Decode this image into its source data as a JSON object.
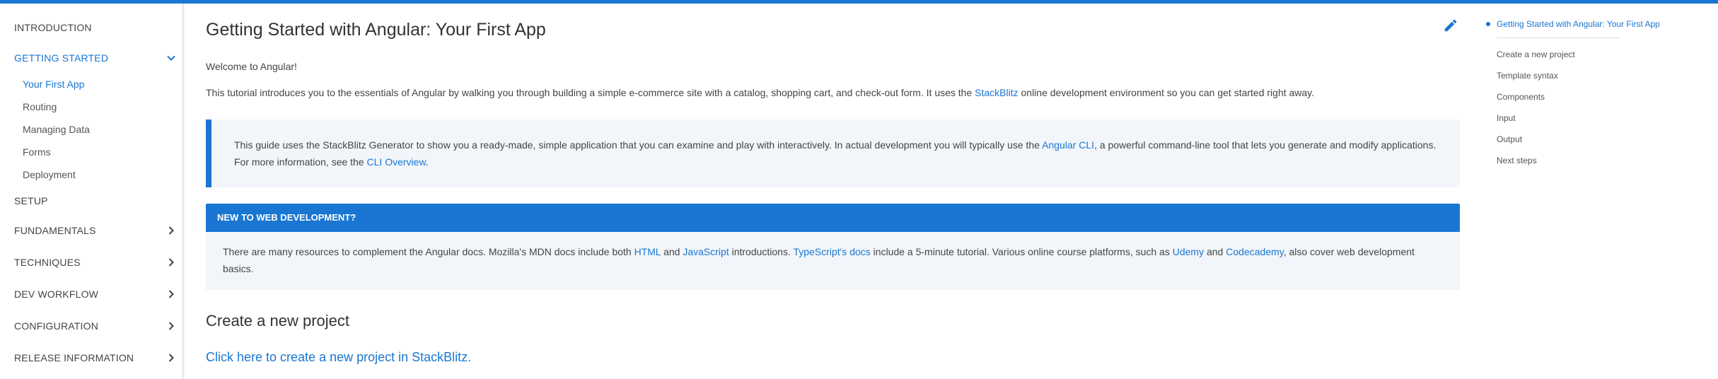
{
  "sidebar": {
    "top_items": [
      {
        "label": "INTRODUCTION"
      },
      {
        "label": "GETTING STARTED"
      },
      {
        "label": "SETUP"
      },
      {
        "label": "FUNDAMENTALS"
      },
      {
        "label": "TECHNIQUES"
      },
      {
        "label": "DEV WORKFLOW"
      },
      {
        "label": "CONFIGURATION"
      },
      {
        "label": "RELEASE INFORMATION"
      }
    ],
    "getting_started_children": [
      {
        "label": "Your First App"
      },
      {
        "label": "Routing"
      },
      {
        "label": "Managing Data"
      },
      {
        "label": "Forms"
      },
      {
        "label": "Deployment"
      }
    ]
  },
  "main": {
    "title": "Getting Started with Angular: Your First App",
    "welcome": "Welcome to Angular!",
    "intro_before": "This tutorial introduces you to the essentials of Angular by walking you through building a simple e-commerce site with a catalog, shopping cart, and check-out form. It uses the ",
    "intro_link": "StackBlitz",
    "intro_after": " online development environment so you can get started right away.",
    "callout1": {
      "before": "This guide uses the StackBlitz Generator to show you a ready-made, simple application that you can examine and play with interactively. In actual development you will typically use the ",
      "link1": "Angular CLI",
      "middle": ", a powerful command-line tool that lets you generate and modify applications. For more information, see the ",
      "link2": "CLI Overview",
      "after": "."
    },
    "callout2": {
      "header": "NEW TO WEB DEVELOPMENT?",
      "t1": "There are many resources to complement the Angular docs. Mozilla's MDN docs include both ",
      "l1": "HTML",
      "t2": " and ",
      "l2": "JavaScript",
      "t3": " introductions. ",
      "l3": "TypeScript's docs",
      "t4": " include a 5-minute tutorial. Various online course platforms, such as ",
      "l4": "Udemy",
      "t5": " and ",
      "l5": "Codecademy",
      "t6": ", also cover web development basics."
    },
    "section_heading": "Create a new project",
    "section_link": "Click here to create a new project in StackBlitz."
  },
  "toc": {
    "items": [
      {
        "label": "Getting Started with Angular: Your First App"
      },
      {
        "label": "Create a new project"
      },
      {
        "label": "Template syntax"
      },
      {
        "label": "Components"
      },
      {
        "label": "Input"
      },
      {
        "label": "Output"
      },
      {
        "label": "Next steps"
      }
    ]
  },
  "colors": {
    "accent": "#1976d2",
    "callout_bg": "#f2f6fa"
  }
}
